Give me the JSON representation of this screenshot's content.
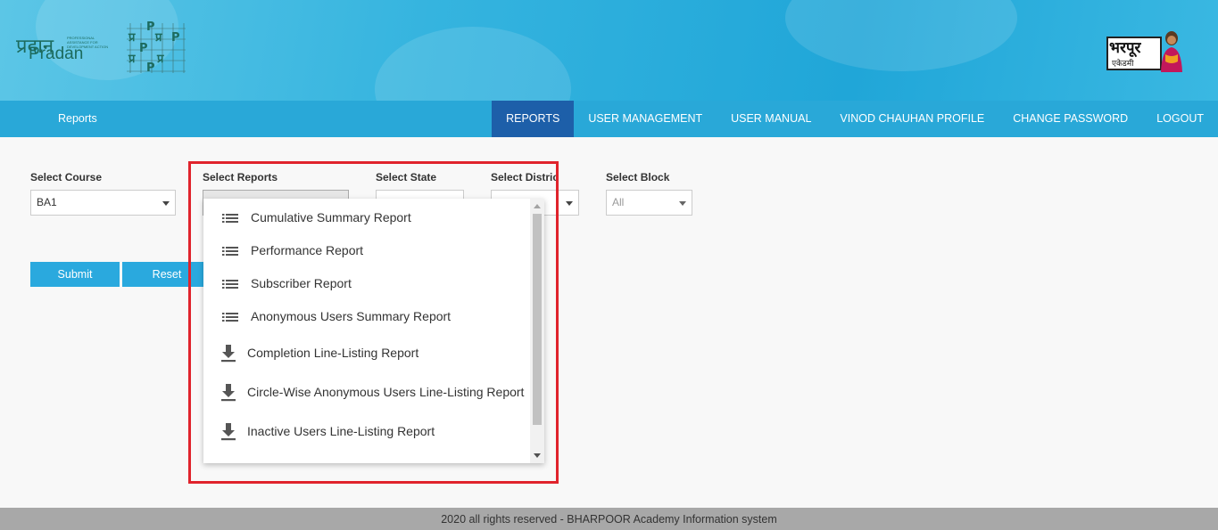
{
  "header": {
    "left_logo": {
      "devanagari": "प्रदान",
      "latin": "Pradan",
      "tagline": "PROFESSIONAL ASSISTANCE FOR DEVELOPMENT ACTION"
    },
    "right_logo": {
      "main": "भरपूर",
      "sub": "एकेडमी"
    }
  },
  "navbar": {
    "brand": "Reports",
    "items": [
      {
        "label": "REPORTS",
        "active": true
      },
      {
        "label": "USER MANAGEMENT"
      },
      {
        "label": "USER MANUAL"
      },
      {
        "label": "VINOD CHAUHAN PROFILE"
      },
      {
        "label": "CHANGE PASSWORD"
      },
      {
        "label": "LOGOUT"
      }
    ]
  },
  "form": {
    "course": {
      "label": "Select Course",
      "value": "BA1"
    },
    "reports": {
      "label": "Select Reports",
      "value": ""
    },
    "state": {
      "label": "Select State",
      "value": ""
    },
    "district": {
      "label": "Select District",
      "value": ""
    },
    "block": {
      "label": "Select Block",
      "value": "All"
    },
    "submit_label": "Submit",
    "reset_label": "Reset"
  },
  "dropdown": {
    "items": [
      {
        "label": "Cumulative Summary Report",
        "icon": "list-icon"
      },
      {
        "label": "Performance Report",
        "icon": "list-icon"
      },
      {
        "label": "Subscriber Report",
        "icon": "list-icon"
      },
      {
        "label": "Anonymous Users Summary Report",
        "icon": "list-icon"
      },
      {
        "label": "Completion Line-Listing Report",
        "icon": "download-icon"
      },
      {
        "label": "Circle-Wise Anonymous Users Line-Listing Report",
        "icon": "download-icon"
      },
      {
        "label": "Inactive Users Line-Listing Report",
        "icon": "download-icon"
      }
    ]
  },
  "colors": {
    "navbar": "#29a8d8",
    "active_tab": "#1d5fa9",
    "button": "#2aa9de",
    "highlight": "#e0232c"
  },
  "footer": {
    "text": "2020 all rights reserved - BHARPOOR Academy Information system"
  }
}
